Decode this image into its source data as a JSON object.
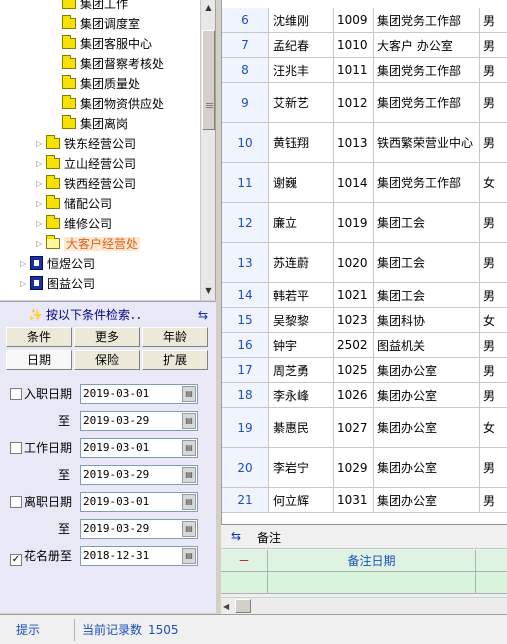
{
  "tree": {
    "nodes": [
      {
        "label": "集团工作",
        "level": 2,
        "icon": "folder"
      },
      {
        "label": "集团调度室",
        "level": 2,
        "icon": "folder"
      },
      {
        "label": "集团客服中心",
        "level": 2,
        "icon": "folder"
      },
      {
        "label": "集团督察考核处",
        "level": 2,
        "icon": "folder"
      },
      {
        "label": "集团质量处",
        "level": 2,
        "icon": "folder"
      },
      {
        "label": "集团物资供应处",
        "level": 2,
        "icon": "folder"
      },
      {
        "label": "集团离岗",
        "level": 2,
        "icon": "folder"
      },
      {
        "label": "铁东经营公司",
        "level": 1,
        "icon": "folder",
        "expandable": true
      },
      {
        "label": "立山经营公司",
        "level": 1,
        "icon": "folder",
        "expandable": true
      },
      {
        "label": "铁西经营公司",
        "level": 1,
        "icon": "folder",
        "expandable": true
      },
      {
        "label": "储配公司",
        "level": 1,
        "icon": "folder",
        "expandable": true
      },
      {
        "label": "维修公司",
        "level": 1,
        "icon": "folder",
        "expandable": true
      },
      {
        "label": "大客户经营处",
        "level": 1,
        "icon": "folder-open",
        "expandable": true,
        "selected": true
      },
      {
        "label": "恒煜公司",
        "level": 0,
        "icon": "building",
        "expandable": true
      },
      {
        "label": "图益公司",
        "level": 0,
        "icon": "building",
        "expandable": true
      }
    ]
  },
  "search": {
    "header": "按以下条件检索．．",
    "tabs_row1": [
      "条件",
      "更多",
      "年龄"
    ],
    "tabs_row2": [
      "日期",
      "保险",
      "扩展"
    ],
    "to_label": "至",
    "filters": [
      {
        "label": "入职日期",
        "checked": false,
        "from": "2019-03-01",
        "to": "2019-03-29"
      },
      {
        "label": "工作日期",
        "checked": false,
        "from": "2019-03-01",
        "to": "2019-03-29"
      },
      {
        "label": "离职日期",
        "checked": false,
        "from": "2019-03-01",
        "to": "2019-03-29"
      }
    ],
    "roster": {
      "label": "花名册至",
      "checked": true,
      "value": "2018-12-31"
    }
  },
  "grid": {
    "rows": [
      {
        "idx": "6",
        "name": "沈维刚",
        "code": "1009",
        "dept": "集团党务工作部",
        "extra": "男",
        "tall": false
      },
      {
        "idx": "7",
        "name": "孟纪春",
        "code": "1010",
        "dept": "大客户 办公室",
        "extra": "男",
        "tall": false
      },
      {
        "idx": "8",
        "name": "汪兆丰",
        "code": "1011",
        "dept": "集团党务工作部",
        "extra": "男",
        "tall": false
      },
      {
        "idx": "9",
        "name": "艾新艺",
        "code": "1012",
        "dept": "集团党务工作部",
        "extra": "男",
        "tall": true
      },
      {
        "idx": "10",
        "name": "黄钰翔",
        "code": "1013",
        "dept": "铁西繁荣营业中心",
        "extra": "男",
        "tall": true
      },
      {
        "idx": "11",
        "name": "谢巍",
        "code": "1014",
        "dept": "集团党务工作部",
        "extra": "女",
        "tall": true
      },
      {
        "idx": "12",
        "name": "廉立",
        "code": "1019",
        "dept": "集团工会",
        "extra": "男",
        "tall": true
      },
      {
        "idx": "13",
        "name": "苏连蔚",
        "code": "1020",
        "dept": "集团工会",
        "extra": "男",
        "tall": true
      },
      {
        "idx": "14",
        "name": "韩若平",
        "code": "1021",
        "dept": "集团工会",
        "extra": "男",
        "tall": false
      },
      {
        "idx": "15",
        "name": "吴黎黎",
        "code": "1023",
        "dept": "集团科协",
        "extra": "女",
        "tall": false
      },
      {
        "idx": "16",
        "name": "钟宇",
        "code": "2502",
        "dept": "图益机关",
        "extra": "男",
        "tall": false
      },
      {
        "idx": "17",
        "name": "周芝勇",
        "code": "1025",
        "dept": "集团办公室",
        "extra": "男",
        "tall": false
      },
      {
        "idx": "18",
        "name": "李永峰",
        "code": "1026",
        "dept": "集团办公室",
        "extra": "男",
        "tall": false
      },
      {
        "idx": "19",
        "name": "綦惠民",
        "code": "1027",
        "dept": "集团办公室",
        "extra": "女",
        "tall": true
      },
      {
        "idx": "20",
        "name": "李岩宁",
        "code": "1029",
        "dept": "集团办公室",
        "extra": "男",
        "tall": true
      },
      {
        "idx": "21",
        "name": "何立辉",
        "code": "1031",
        "dept": "集团办公室",
        "extra": "男",
        "tall": false
      }
    ]
  },
  "notes": {
    "title": "备注",
    "col_marker": "－",
    "col_date": "备注日期"
  },
  "status": {
    "hint": "提示",
    "record_label": "当前记录数",
    "record_count": "1505"
  }
}
